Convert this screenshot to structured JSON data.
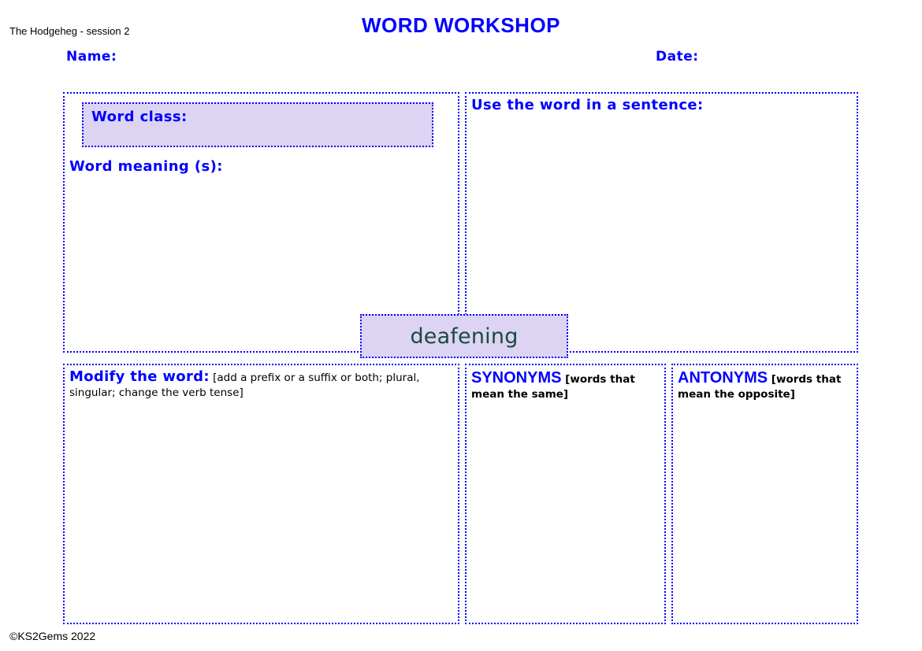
{
  "header": {
    "session_label": "The Hodgeheg - session 2",
    "title": "WORD WORKSHOP",
    "name_label": "Name:",
    "date_label": "Date:"
  },
  "word_chip": {
    "word": "deafening"
  },
  "panels": {
    "word_meaning": {
      "word_class_label": "Word class:",
      "word_meaning_label": "Word meaning (s):"
    },
    "sentence": {
      "label": "Use the word in a sentence:"
    },
    "modify": {
      "label": "Modify the word:",
      "note": "[add a prefix or a suffix or both; plural, singular; change the verb tense]"
    },
    "synonyms": {
      "label": "SYNONYMS",
      "note": "[words that mean the same]"
    },
    "antonyms": {
      "label": "ANTONYMS",
      "note": "[words that mean the opposite]"
    }
  },
  "footer": {
    "copyright": "©KS2Gems 2022"
  },
  "colors": {
    "accent_blue": "#0000ff",
    "lavender_fill": "#ddd4f3",
    "word_text": "#1b4a3f",
    "black_text": "#000000",
    "page_background": "#ffffff"
  }
}
